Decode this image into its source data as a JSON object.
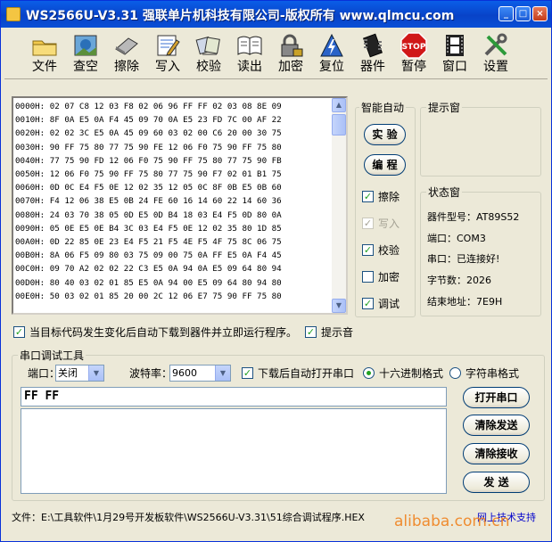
{
  "window": {
    "title": "WS2566U-V3.31 强联单片机科技有限公司-版权所有 www.qlmcu.com"
  },
  "toolbar": [
    {
      "label": "文件",
      "icon": "folder-icon"
    },
    {
      "label": "查空",
      "icon": "picture-icon"
    },
    {
      "label": "擦除",
      "icon": "eraser-icon"
    },
    {
      "label": "写入",
      "icon": "write-icon"
    },
    {
      "label": "校验",
      "icon": "verify-icon"
    },
    {
      "label": "读出",
      "icon": "book-icon"
    },
    {
      "label": "加密",
      "icon": "lock-icon"
    },
    {
      "label": "复位",
      "icon": "lightning-icon"
    },
    {
      "label": "器件",
      "icon": "chip-icon"
    },
    {
      "label": "暂停",
      "icon": "stop-icon",
      "stop_text": "STOP"
    },
    {
      "label": "窗口",
      "icon": "film-icon"
    },
    {
      "label": "设置",
      "icon": "tools-icon"
    }
  ],
  "hex_rows": [
    "0000H: 02 07 C8 12 03 F8 02 06 96 FF FF 02 03 08 8E 09",
    "0010H: 8F 0A E5 0A F4 45 09 70 0A E5 23 FD 7C 00 AF 22",
    "0020H: 02 02 3C E5 0A 45 09 60 03 02 00 C6 20 00 30 75",
    "0030H: 90 FF 75 80 77 75 90 FE 12 06 F0 75 90 FF 75 80",
    "0040H: 77 75 90 FD 12 06 F0 75 90 FF 75 80 77 75 90 FB",
    "0050H: 12 06 F0 75 90 FF 75 80 77 75 90 F7 02 01 B1 75",
    "0060H: 0D 0C E4 F5 0E 12 02 35 12 05 0C 8F 0B E5 0B 60",
    "0070H: F4 12 06 38 E5 0B 24 FE 60 16 14 60 22 14 60 36",
    "0080H: 24 03 70 38 05 0D E5 0D B4 18 03 E4 F5 0D 80 0A",
    "0090H: 05 0E E5 0E B4 3C 03 E4 F5 0E 12 02 35 80 1D 85",
    "00A0H: 0D 22 85 0E 23 E4 F5 21 F5 4E F5 4F 75 8C 06 75",
    "00B0H: 8A 06 F5 09 80 03 75 09 00 75 0A FF E5 0A F4 45",
    "00C0H: 09 70 A2 02 02 22 C3 E5 0A 94 0A E5 09 64 80 94",
    "00D0H: 80 40 03 02 01 85 E5 0A 94 00 E5 09 64 80 94 80",
    "00E0H: 50 03 02 01 85 20 00 2C 12 06 E7 75 90 FF 75 80"
  ],
  "smart": {
    "title": "智能自动",
    "btn_test": "实 验",
    "btn_program": "编 程",
    "checks": [
      {
        "label": "擦除",
        "checked": true,
        "disabled": false
      },
      {
        "label": "写入",
        "checked": true,
        "disabled": true
      },
      {
        "label": "校验",
        "checked": true,
        "disabled": false
      },
      {
        "label": "加密",
        "checked": false,
        "disabled": false
      },
      {
        "label": "调试",
        "checked": true,
        "disabled": false
      }
    ]
  },
  "hint": {
    "title": "提示窗"
  },
  "status": {
    "title": "状态窗",
    "model": "器件型号：AT89S52",
    "port": "端口：COM3",
    "conn": "串口：已连接好!",
    "bytes": "字节数：2026",
    "end": "结束地址：7E9H"
  },
  "options": {
    "auto_download": "当目标代码发生变化后自动下载到器件并立即运行程序。",
    "sound": "提示音"
  },
  "serial": {
    "title": "串口调试工具",
    "port_label": "端口：",
    "port_value": "关闭",
    "baud_label": "波特率：",
    "baud_value": "9600",
    "auto_open": "下载后自动打开串口",
    "hex_format": "十六进制格式",
    "char_format": "字符串格式",
    "send_text": "FF FF",
    "btn_open": "打开串口",
    "btn_clear_send": "清除发送",
    "btn_clear_recv": "清除接收",
    "btn_send": "发 送"
  },
  "statusbar": {
    "file": "文件：E:\\工具软件\\1月29号开发板软件\\WS2566U-V3.31\\51综合调试程序.HEX",
    "link": "网上技术支持"
  },
  "watermark": "alibaba.com.cn"
}
